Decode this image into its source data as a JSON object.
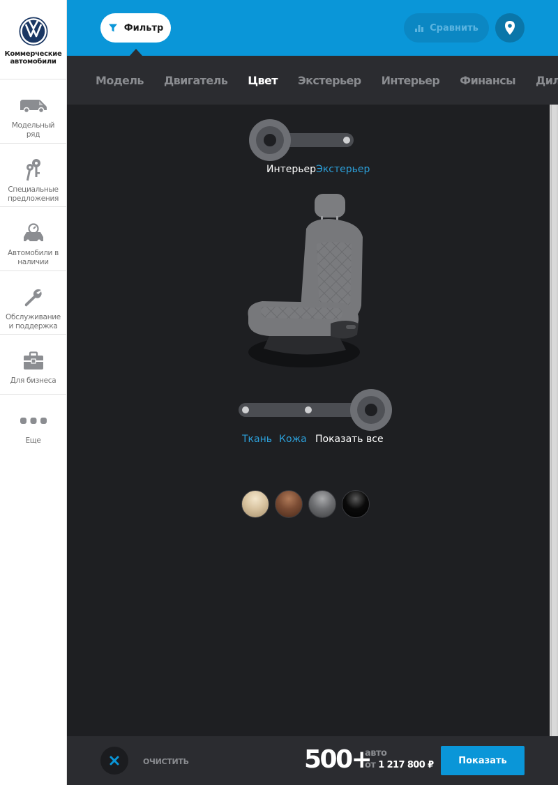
{
  "brand": {
    "line1": "Коммерческие",
    "line2": "автомобили"
  },
  "sidebar": {
    "items": [
      {
        "icon": "van-icon",
        "line1": "Модельный",
        "line2": "ряд"
      },
      {
        "icon": "keys-icon",
        "line1": "Специальные",
        "line2": "предложения"
      },
      {
        "icon": "car-stock-icon",
        "line1": "Автомобили в",
        "line2": "наличии"
      },
      {
        "icon": "wrench-icon",
        "line1": "Обслуживание",
        "line2": "и поддержка"
      },
      {
        "icon": "briefcase-icon",
        "line1": "Для бизнеса",
        "line2": ""
      },
      {
        "icon": "more-dots-icon",
        "line1": "Еще",
        "line2": ""
      }
    ]
  },
  "topbar": {
    "filter_label": "Фильтр",
    "compare_label": "Сравнить"
  },
  "tabs": [
    {
      "label": "Модель",
      "active": false
    },
    {
      "label": "Двигатель",
      "active": false
    },
    {
      "label": "Цвет",
      "active": true
    },
    {
      "label": "Экстерьер",
      "active": false
    },
    {
      "label": "Интерьер",
      "active": false
    },
    {
      "label": "Финансы",
      "active": false
    },
    {
      "label": "Дилеры",
      "active": false
    }
  ],
  "color_toggle": {
    "interior_label": "Интерьер",
    "exterior_label": "Экстерьер",
    "selected": "Интерьер"
  },
  "material_filter": {
    "options": [
      "Ткань",
      "Кожа",
      "Показать все"
    ],
    "selected": "Показать все"
  },
  "swatches": [
    {
      "name": "beige",
      "color": "#d8c3a0"
    },
    {
      "name": "brown",
      "color": "#7b4c34"
    },
    {
      "name": "grey",
      "color": "#6e6f72"
    },
    {
      "name": "black",
      "color": "#0a0a0a"
    }
  ],
  "bottombar": {
    "clear_label": "ОЧИСТИТЬ",
    "count": "500+",
    "unit_label": "авто",
    "from_label": "от",
    "price": "1 217 800 ₽",
    "show_label": "Показать"
  },
  "colors": {
    "accent": "#0a96d8",
    "dark_bg": "#1e1f22",
    "panel_bg": "#2b2c30",
    "link_blue": "#2c9fd9"
  }
}
